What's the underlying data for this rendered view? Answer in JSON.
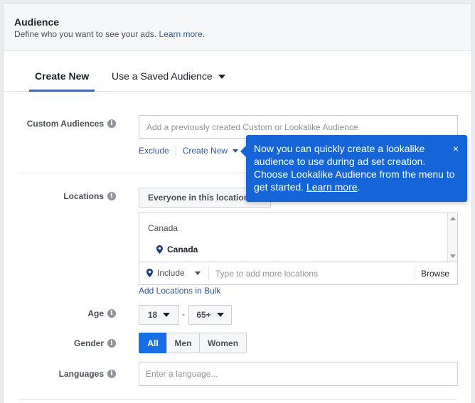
{
  "audience": {
    "title": "Audience",
    "subtitle": "Define who you want to see your ads.",
    "learn_more": "Learn more."
  },
  "tabs": [
    {
      "label": "Create New"
    },
    {
      "label": "Use a Saved Audience"
    }
  ],
  "custom_audiences": {
    "label": "Custom Audiences",
    "placeholder": "Add a previously created Custom or Lookalike Audience",
    "exclude": "Exclude",
    "create_new": "Create New"
  },
  "tooltip": {
    "text": "Now you can quickly create a lookalike audience to use during ad set creation. Choose Lookalike Audience from the menu to get started.",
    "link": "Learn more",
    "period": ".",
    "close": "×"
  },
  "locations": {
    "label": "Locations",
    "dropdown": "Everyone in this location",
    "group": "Canada",
    "item": "Canada",
    "include": "Include",
    "placeholder": "Type to add more locations",
    "browse": "Browse",
    "bulk": "Add Locations in Bulk"
  },
  "age": {
    "label": "Age",
    "min": "18",
    "separator": "-",
    "max": "65+"
  },
  "gender": {
    "label": "Gender",
    "options": [
      "All",
      "Men",
      "Women"
    ],
    "selected": "All"
  },
  "languages": {
    "label": "Languages",
    "placeholder": "Enter a language..."
  },
  "colors": {
    "accent": "#166fe5",
    "link": "#365899",
    "tooltip": "#1565d8"
  }
}
